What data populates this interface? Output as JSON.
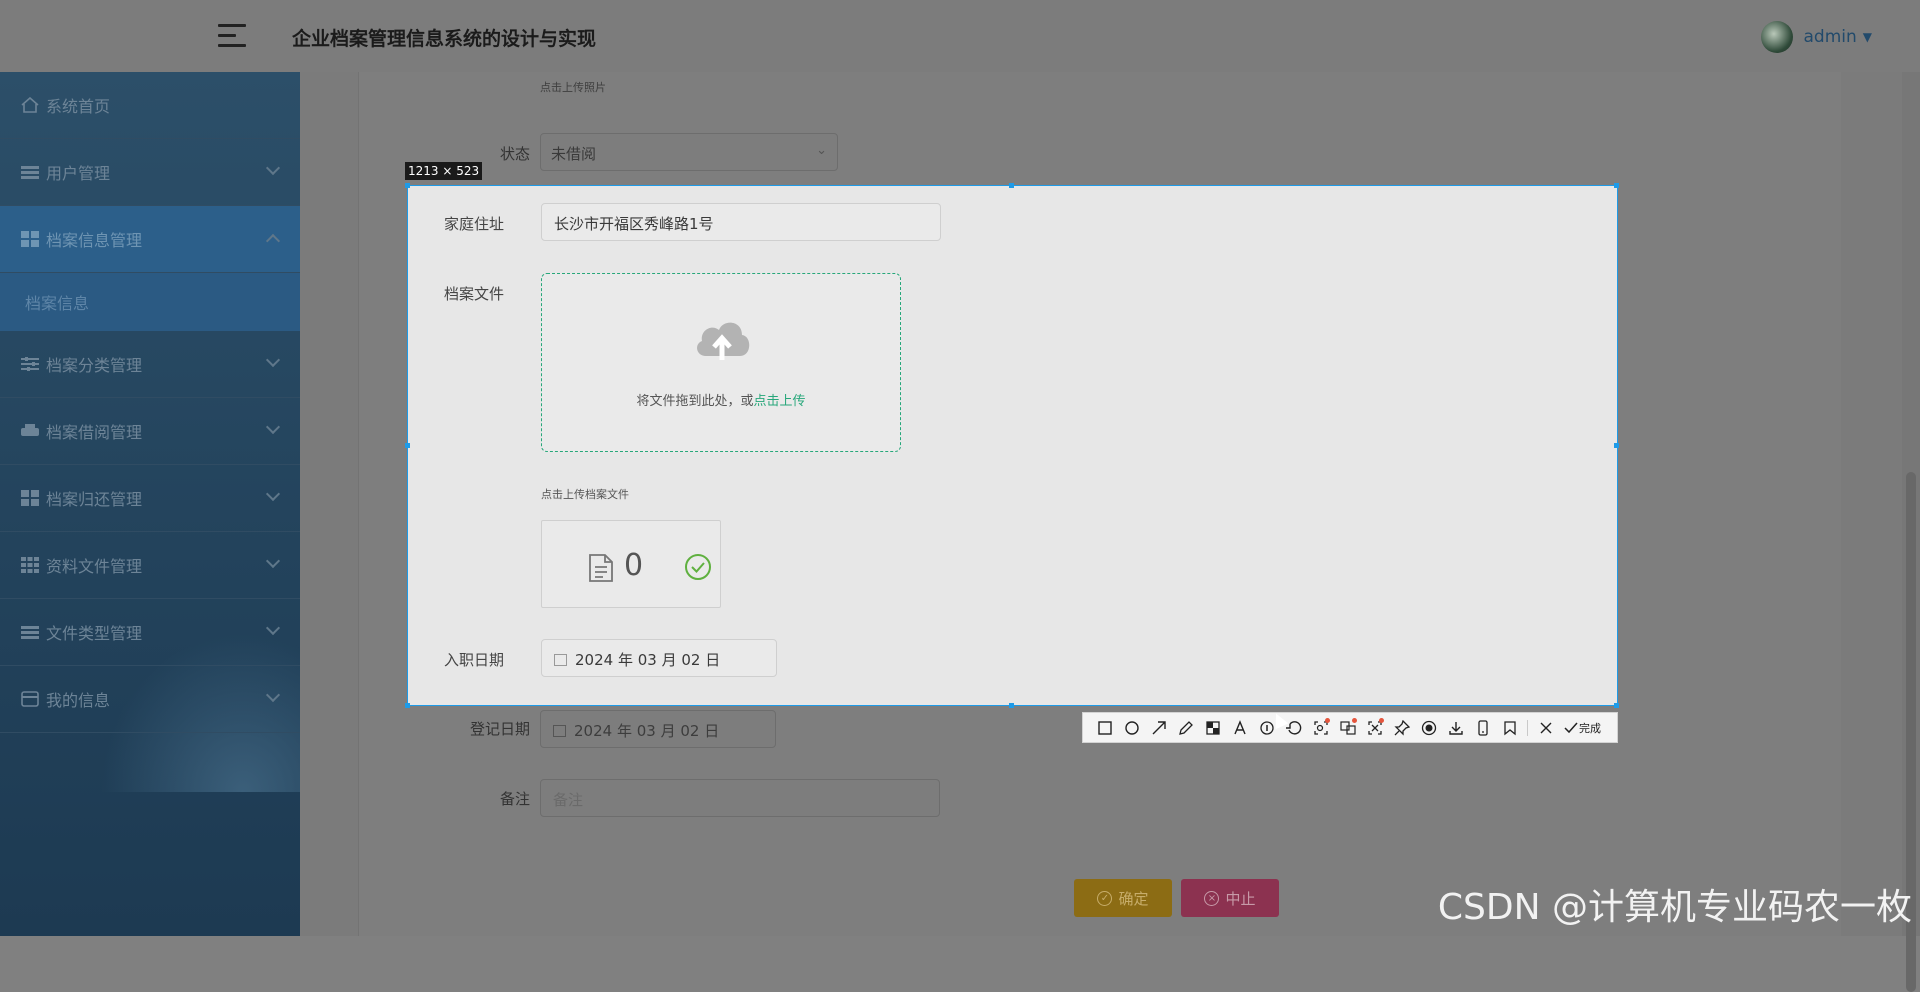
{
  "app": {
    "title": "企业档案管理信息系统的设计与实现"
  },
  "user": {
    "name": "admin",
    "caret": "▼"
  },
  "sidebar": {
    "items": [
      {
        "label": "系统首页",
        "icon": "home-icon"
      },
      {
        "label": "用户管理",
        "icon": "list-icon"
      },
      {
        "label": "档案信息管理",
        "icon": "grid-icon",
        "expanded": true
      },
      {
        "label": "档案分类管理",
        "icon": "sliders-icon"
      },
      {
        "label": "档案借阅管理",
        "icon": "printer-icon"
      },
      {
        "label": "档案归还管理",
        "icon": "grid-icon"
      },
      {
        "label": "资料文件管理",
        "icon": "grid-icon"
      },
      {
        "label": "文件类型管理",
        "icon": "list-icon"
      },
      {
        "label": "我的信息",
        "icon": "card-icon"
      }
    ],
    "sub_item": "档案信息"
  },
  "form": {
    "upload_photo_hint": "点击上传照片",
    "status_label": "状态",
    "status_value": "未借阅",
    "address_label": "家庭住址",
    "address_value": "长沙市开福区秀峰路1号",
    "file_label": "档案文件",
    "drop_text": "将文件拖到此处，或",
    "drop_link": "点击上传",
    "upload_file_hint": "点击上传档案文件",
    "file_count": "0",
    "hire_date_label": "入职日期",
    "hire_date_value": "2024 年 03 月 02 日",
    "register_date_label": "登记日期",
    "register_date_value": "2024 年 03 月 02 日",
    "remark_label": "备注",
    "remark_placeholder": "备注",
    "confirm_button": "确定",
    "abort_button": "中止"
  },
  "capture": {
    "dimensions": "1213 × 523",
    "done_label": "完成",
    "accent": "#1e9be8"
  },
  "watermark": "CSDN @计算机专业码农一枚"
}
